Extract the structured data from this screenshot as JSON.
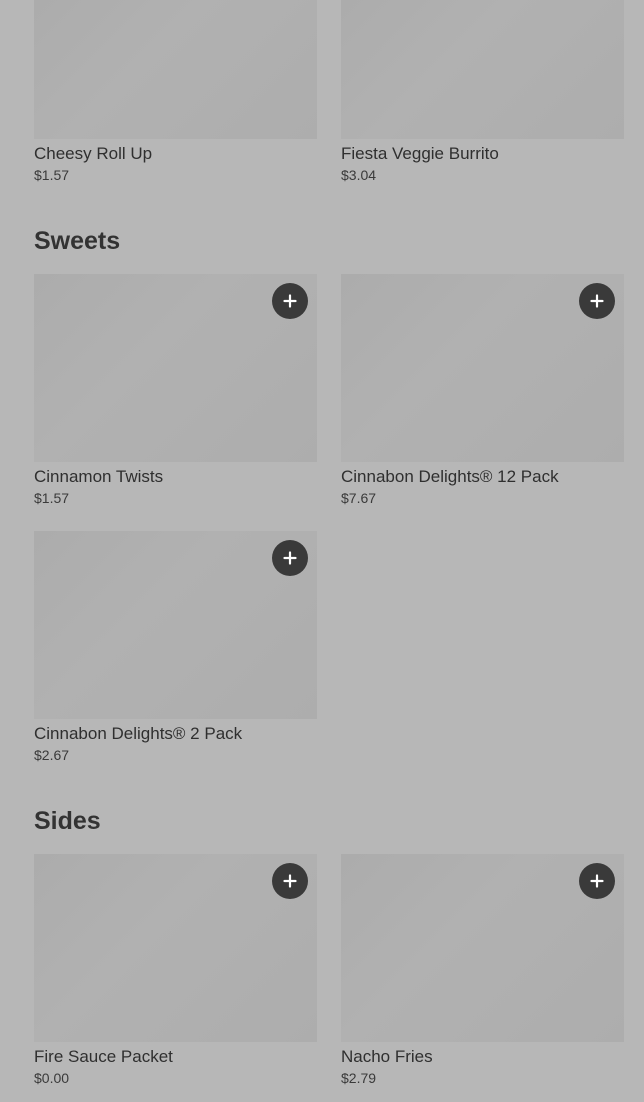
{
  "top_items": [
    {
      "name": "Cheesy Roll Up",
      "price": "$1.57"
    },
    {
      "name": "Fiesta Veggie Burrito",
      "price": "$3.04"
    }
  ],
  "sections": [
    {
      "title": "Sweets",
      "items": [
        {
          "name": "Cinnamon Twists",
          "price": "$1.57",
          "add_icon": "plus-icon"
        },
        {
          "name": "Cinnabon Delights® 12 Pack",
          "price": "$7.67",
          "add_icon": "plus-icon"
        },
        {
          "name": "Cinnabon Delights® 2 Pack",
          "price": "$2.67",
          "add_icon": "plus-icon"
        }
      ]
    },
    {
      "title": "Sides",
      "items": [
        {
          "name": "Fire Sauce Packet",
          "price": "$0.00",
          "add_icon": "plus-icon"
        },
        {
          "name": "Nacho Fries",
          "price": "$2.79",
          "add_icon": "plus-icon"
        }
      ]
    }
  ],
  "colors": {
    "background": "#b7b7b7",
    "image_placeholder": "#adadad",
    "add_button": "#3a3a3a",
    "add_icon": "#ffffff"
  }
}
